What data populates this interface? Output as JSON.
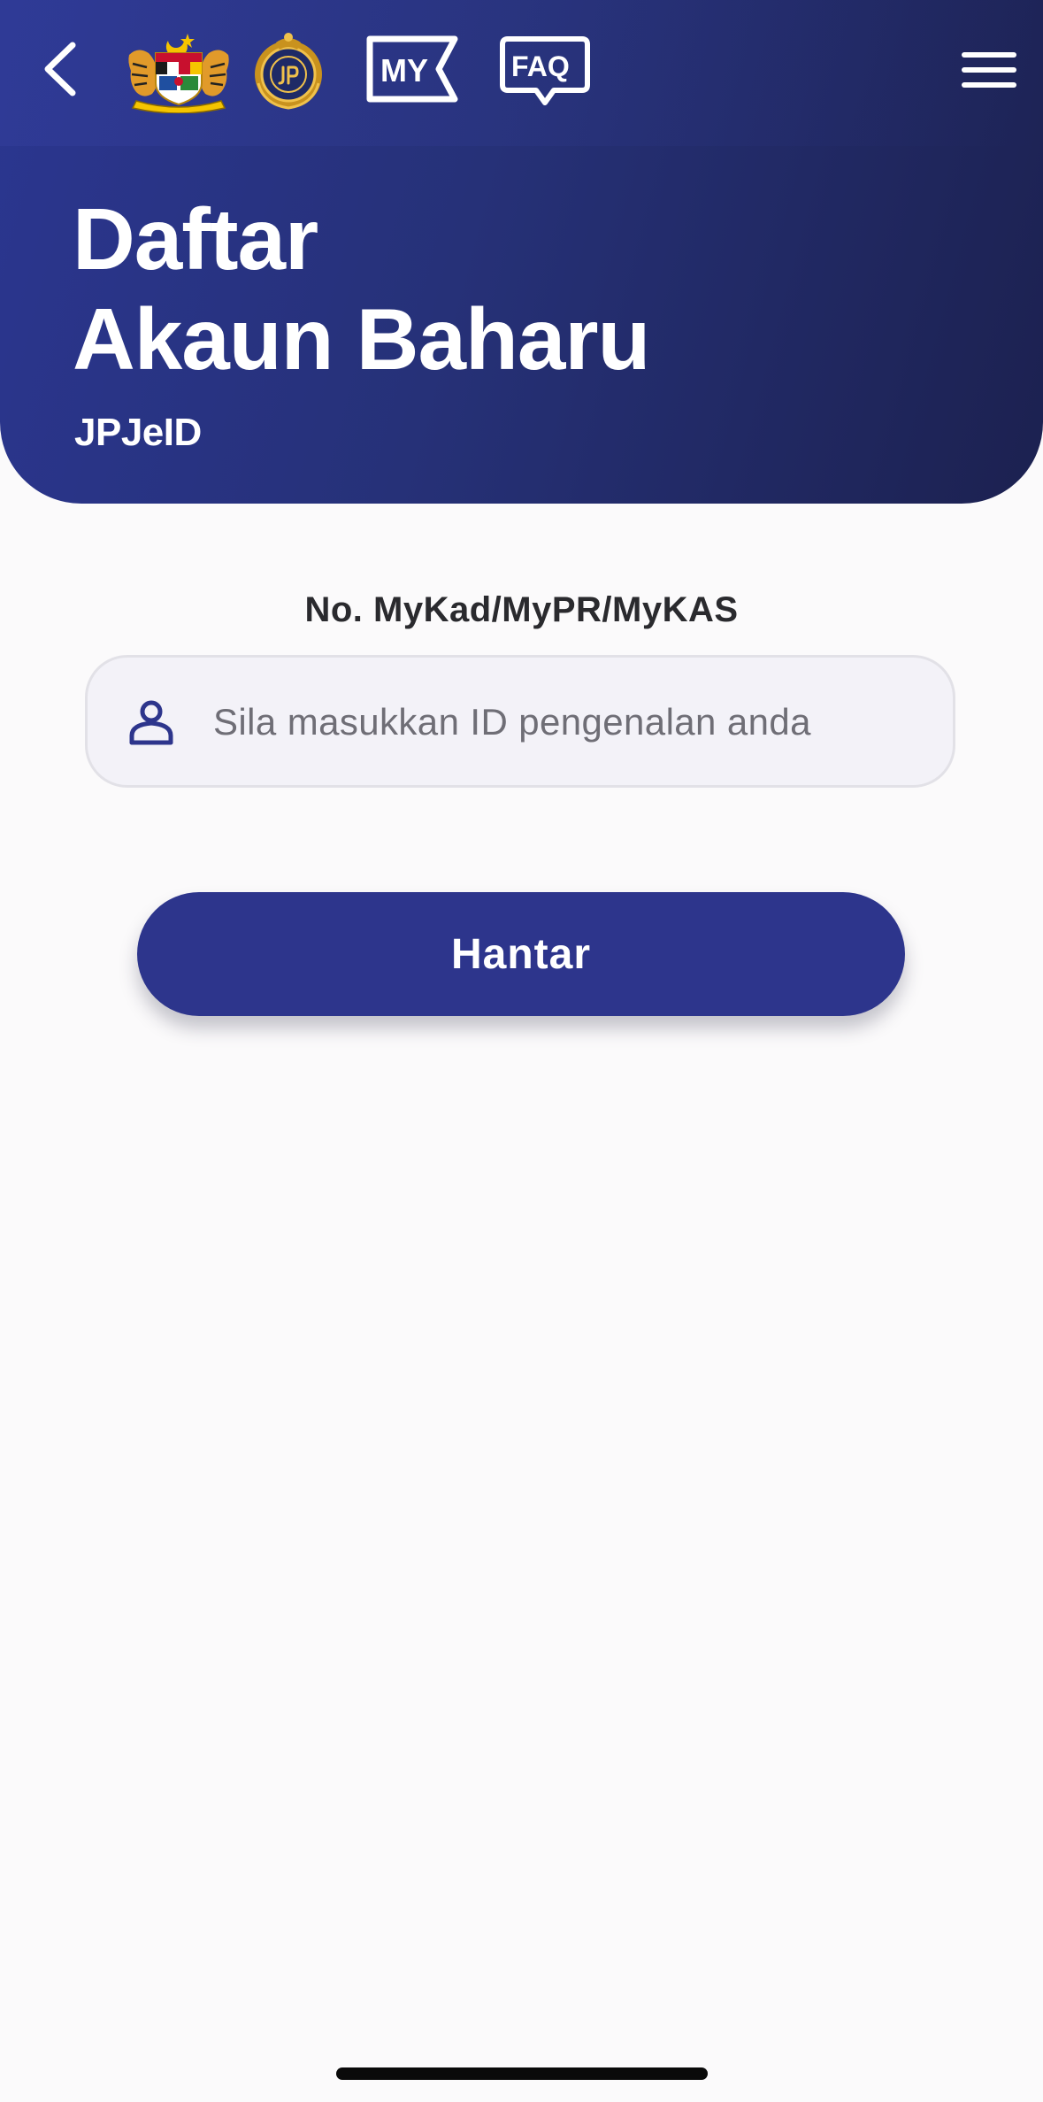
{
  "header": {
    "title_line1": "Daftar",
    "title_line2": "Akaun Baharu",
    "subtitle": "JPJeID",
    "icons": {
      "back": "chevron-left-icon",
      "crest": "malaysia-coat-of-arms-logo",
      "agency_logo": "jpj-logo",
      "my": "my-icon",
      "faq": "faq-icon",
      "menu": "hamburger-menu-icon"
    },
    "my_label": "MY",
    "faq_label": "FAQ"
  },
  "form": {
    "id_label": "No. MyKad/MyPR/MyKAS",
    "id_placeholder": "Sila masukkan ID pengenalan anda",
    "id_value": "",
    "submit_label": "Hantar"
  },
  "colors": {
    "header_gradient_start": "#2b3690",
    "header_gradient_end": "#1c2150",
    "primary_button": "#2d358c",
    "input_background": "#f3f2f8",
    "page_background": "#fbfafb"
  }
}
